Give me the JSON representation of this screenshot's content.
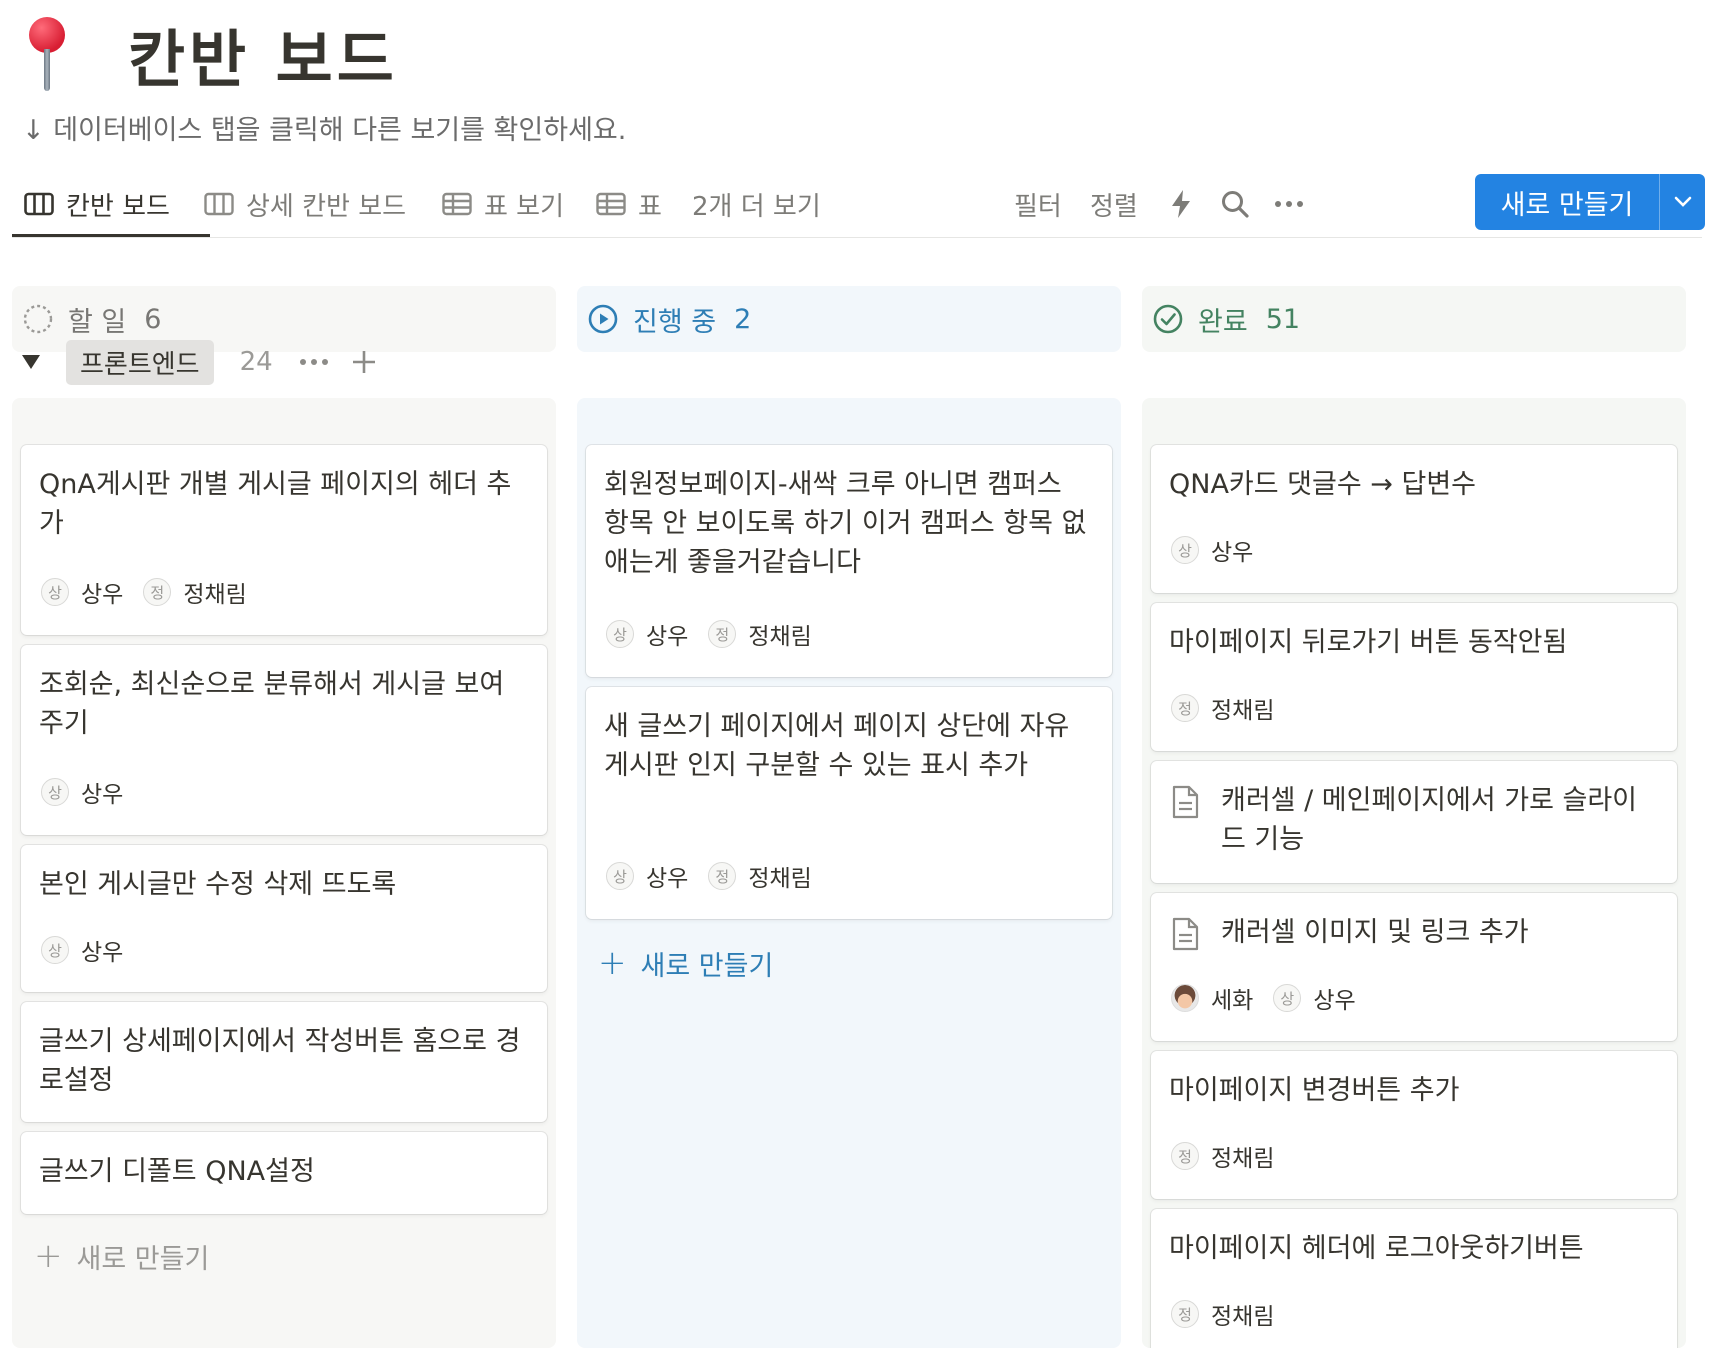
{
  "page": {
    "title": "칸반 보드",
    "subtitle": "↓ 데이터베이스 탭을 클릭해 다른 보기를 확인하세요."
  },
  "tabs": [
    {
      "label": "칸반 보드",
      "icon": "board-icon",
      "active": true
    },
    {
      "label": "상세 칸반 보드",
      "icon": "board-icon",
      "active": false
    },
    {
      "label": "표 보기",
      "icon": "table-icon",
      "active": false
    },
    {
      "label": "표",
      "icon": "table-icon",
      "active": false
    },
    {
      "label": "2개 더 보기",
      "active": false
    }
  ],
  "toolbar": {
    "filter": "필터",
    "sort": "정렬",
    "new_button": "새로 만들기",
    "icons": [
      "lightning-icon",
      "search-icon",
      "more-icon",
      "chevron-down-icon"
    ]
  },
  "group": {
    "name": "프론트엔드",
    "count": "24"
  },
  "colors": {
    "accent": "#2383e2",
    "todo_bg": "#f7f7f5",
    "progress_bg": "#f2f7fb",
    "progress_text": "#2e7eb5",
    "done_bg": "#f5f7f4",
    "done_text": "#448361"
  },
  "columns": [
    {
      "status": "할 일",
      "count": "6",
      "cards": [
        {
          "title": "QnA게시판 개별 게시글 페이지의 헤더 추가",
          "people": [
            "상우",
            "정채림"
          ]
        },
        {
          "title": "조회순, 최신순으로 분류해서 게시글 보여주기",
          "people": [
            "상우"
          ]
        },
        {
          "title": "본인 게시글만 수정 삭제 뜨도록",
          "people": [
            "상우"
          ]
        },
        {
          "title": "글쓰기 상세페이지에서 작성버튼 홈으로 경로설정",
          "people": []
        },
        {
          "title": "글쓰기 디폴트 QNA설정",
          "people": []
        }
      ],
      "new_label": "새로 만들기"
    },
    {
      "status": "진행 중",
      "count": "2",
      "cards": [
        {
          "title": "회원정보페이지-새싹 크루 아니면 캠퍼스 항목 안 보이도록 하기 이거 캠퍼스 항목 없애는게 좋을거같습니다",
          "people": [
            "상우",
            "정채림"
          ]
        },
        {
          "title": "새 글쓰기 페이지에서 페이지 상단에 자유게시판 인지 구분할 수 있는 표시 추가",
          "people": [
            "상우",
            "정채림"
          ]
        }
      ],
      "new_label": "새로 만들기"
    },
    {
      "status": "완료",
      "count": "51",
      "cards": [
        {
          "title": "QNA카드 댓글수 → 답변수",
          "people": [
            "상우"
          ]
        },
        {
          "title": "마이페이지 뒤로가기 버튼 동작안됨",
          "people": [
            "정채림"
          ]
        },
        {
          "title": "캐러셀 / 메인페이지에서 가로 슬라이드 기능",
          "people": []
        },
        {
          "title": "캐러셀 이미지 및 링크 추가",
          "people": [
            "세화",
            "상우"
          ]
        },
        {
          "title": "마이페이지 변경버튼 추가",
          "people": [
            "정채림"
          ]
        },
        {
          "title": "마이페이지 헤더에 로그아웃하기버튼",
          "people": [
            "정채림"
          ]
        }
      ]
    }
  ],
  "avatar_initials": {
    "상우": "상",
    "정채림": "정"
  }
}
